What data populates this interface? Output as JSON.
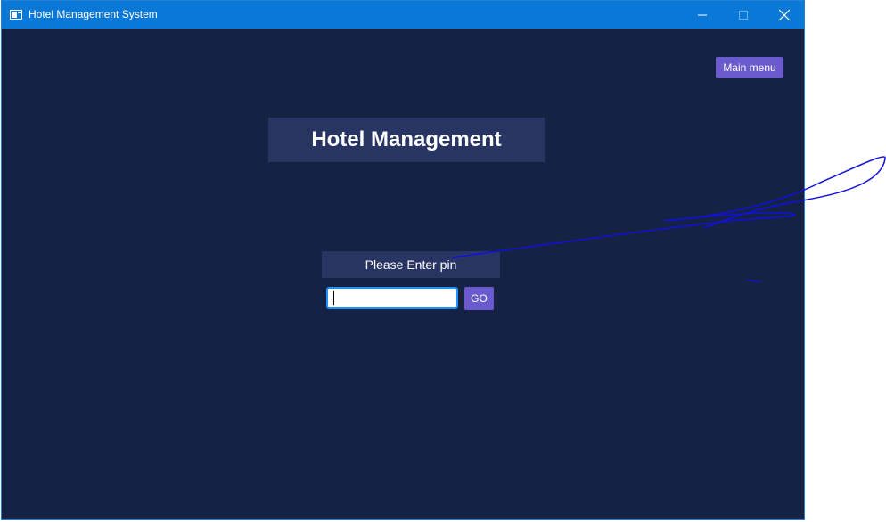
{
  "window": {
    "title": "Hotel Management System",
    "icons": {
      "app": "window-app-icon",
      "minimize": "minimize-icon",
      "maximize": "maximize-icon",
      "close": "close-icon"
    }
  },
  "nav": {
    "main_menu_label": "Main menu"
  },
  "main": {
    "heading": "Hotel Management",
    "pin_label": "Please Enter pin",
    "pin_value": "",
    "go_label": "GO"
  },
  "colors": {
    "titlebar": "#0a78d7",
    "background": "#152243",
    "panel": "#283563",
    "accent_button": "#6a5acd",
    "annotation_ink": "#1010e0"
  }
}
